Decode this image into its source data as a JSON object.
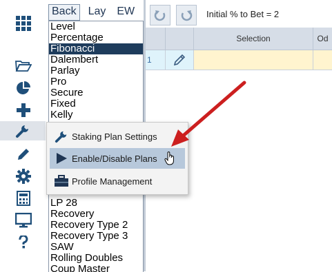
{
  "sidebar": {
    "icons": [
      "apps-grid-icon",
      "folder-open-icon",
      "pie-chart-icon",
      "plus-icon",
      "wrench-icon",
      "pencil-icon",
      "gear-icon",
      "calculator-icon",
      "monitor-icon",
      "help-icon"
    ],
    "active": "wrench-icon"
  },
  "plan_panel": {
    "tabs": [
      {
        "label": "Back",
        "active": true
      },
      {
        "label": "Lay",
        "active": false
      },
      {
        "label": "EW",
        "active": false
      }
    ],
    "items_top": [
      "Level",
      "Percentage",
      "Fibonacci",
      "Dalembert",
      "Parlay",
      "Pro",
      "Secure",
      "Fixed",
      "Kelly"
    ],
    "selected": "Fibonacci",
    "items_bottom": [
      "LP 28",
      "Recovery",
      "Recovery Type 2",
      "Recovery Type 3",
      "SAW",
      "Rolling Doubles",
      "Coup Master"
    ]
  },
  "toolbar": {
    "info_text": "Initial % to Bet = 2"
  },
  "grid": {
    "columns": [
      "",
      "",
      "Selection",
      "Od"
    ],
    "rows": [
      {
        "num": "1",
        "selection": ""
      }
    ]
  },
  "context_menu": {
    "items": [
      {
        "label": "Staking Plan Settings",
        "icon": "wrench-icon",
        "highlighted": false
      },
      {
        "label": "Enable/Disable Plans",
        "icon": "play-triangle-icon",
        "highlighted": true
      },
      {
        "label": "Profile Management",
        "icon": "briefcase-icon",
        "highlighted": false
      }
    ]
  },
  "colors": {
    "icon_blue": "#1f4f7a",
    "selected_bg": "#1e3c5c",
    "menu_highlight": "#b7c8db",
    "arrow_red": "#cc1f1f"
  }
}
